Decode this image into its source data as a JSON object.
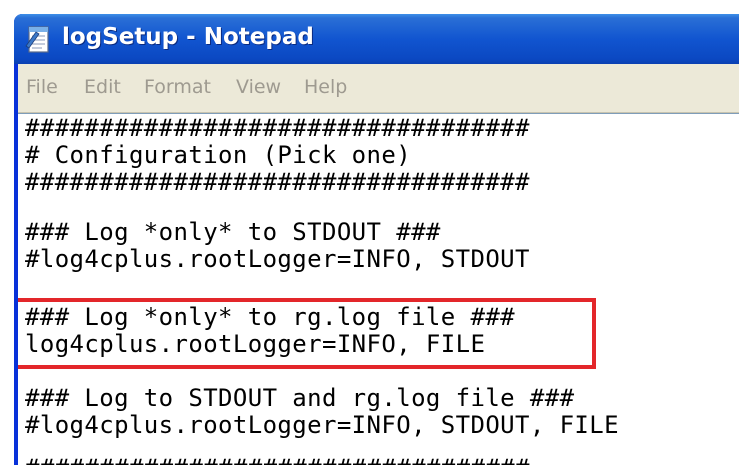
{
  "window": {
    "title": "logSetup - Notepad",
    "app_icon": "notepad-icon"
  },
  "menu": {
    "items": [
      "File",
      "Edit",
      "Format",
      "View",
      "Help"
    ]
  },
  "editor": {
    "lines": [
      "##################################",
      "# Configuration (Pick one)",
      "##################################",
      "",
      "### Log *only* to STDOUT ###",
      "#log4cplus.rootLogger=INFO, STDOUT",
      "",
      "### Log *only* to rg.log file ###",
      "log4cplus.rootLogger=INFO, FILE",
      "",
      "### Log to STDOUT and rg.log file ###",
      "#log4cplus.rootLogger=INFO, STDOUT, FILE",
      "",
      "##################################"
    ]
  },
  "annotation": {
    "highlight_color": "#e3262a"
  },
  "colors": {
    "titlebar": "#1155d0",
    "menubar": "#ece9d8",
    "menu_text_disabled": "#9e9a90"
  }
}
